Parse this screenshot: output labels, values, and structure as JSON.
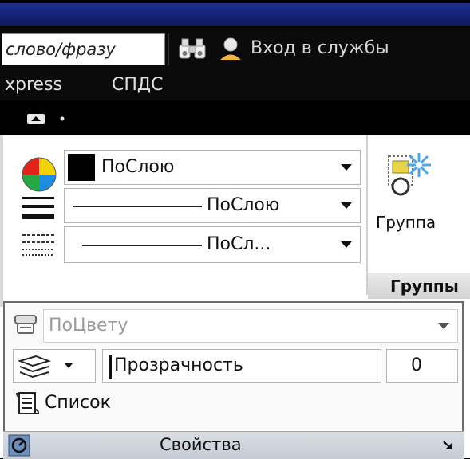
{
  "search": {
    "placeholder": "слово/фразу"
  },
  "header": {
    "login_label": "Вход в службы"
  },
  "menu": {
    "items": [
      "xpress",
      "СПДС"
    ]
  },
  "properties": {
    "color_value": "ПоСлою",
    "linetype_value": "ПоСлою",
    "lineweight_value": "ПоСл...",
    "plotstyle_value": "ПоЦвету",
    "transparency_label": "Прозрачность",
    "transparency_value": "0",
    "list_label": "Список",
    "panel_title": "Свойства"
  },
  "groups": {
    "group_label": "Группа",
    "panel_title": "Группы"
  }
}
